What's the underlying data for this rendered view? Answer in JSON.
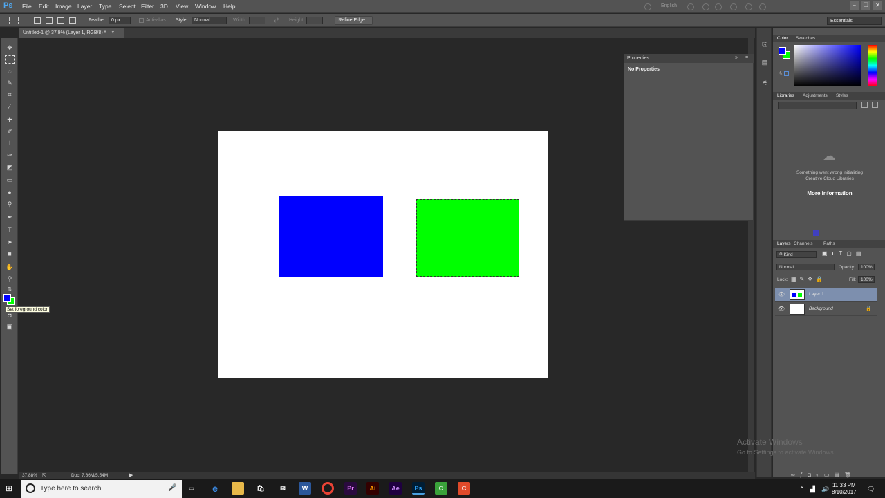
{
  "app": {
    "logo": "Ps"
  },
  "menu": [
    "File",
    "Edit",
    "Image",
    "Layer",
    "Type",
    "Select",
    "Filter",
    "3D",
    "View",
    "Window",
    "Help"
  ],
  "titlebar": {
    "language": "English",
    "minimize": "‒",
    "restore": "❐",
    "close": "✕"
  },
  "options": {
    "feather_label": "Feather:",
    "feather_value": "0 px",
    "antialias_label": "Anti-alias",
    "style_label": "Style:",
    "style_value": "Normal",
    "width_label": "Width:",
    "height_label": "Height:",
    "refine_edge": "Refine Edge...",
    "workspace": "Essentials"
  },
  "document": {
    "tab_title": "Untitled-1 @ 37.9% (Layer 1, RGB/8) *",
    "zoom": "37.88%",
    "doc_size": "Doc: 7.66M/5.54M",
    "colors": {
      "blue_rect": "#0000ff",
      "green_rect": "#00ff00"
    }
  },
  "toolbar": {
    "tooltip": "Set foreground color",
    "foreground": "#0000ff",
    "background": "#00ff00"
  },
  "properties": {
    "title": "Properties",
    "content": "No Properties"
  },
  "color_panel": {
    "tabs": [
      "Color",
      "Swatches"
    ]
  },
  "libraries_panel": {
    "tabs": [
      "Libraries",
      "Adjustments",
      "Styles"
    ],
    "error_line1": "Something went wrong initializing",
    "error_line2": "Creative Cloud Libraries",
    "more_info": "More information"
  },
  "layers_panel": {
    "tabs": [
      "Layers",
      "Channels",
      "Paths"
    ],
    "kind": "Kind",
    "blend_mode": "Normal",
    "opacity_label": "Opacity:",
    "opacity_value": "100%",
    "lock_label": "Lock:",
    "fill_label": "Fill:",
    "fill_value": "100%",
    "layers": [
      {
        "name": "Layer 1",
        "selected": true
      },
      {
        "name": "Background",
        "selected": false,
        "locked": true
      }
    ]
  },
  "watermark": {
    "line1": "Activate Windows",
    "line2": "Go to Settings to activate Windows."
  },
  "taskbar": {
    "search_placeholder": "Type here to search",
    "apps": [
      "task-view",
      "edge",
      "file-explorer",
      "store",
      "mail",
      "word",
      "chrome",
      "premiere",
      "illustrator",
      "after-effects",
      "photoshop",
      "camtasia",
      "camtasia-recorder"
    ],
    "time": "11:33 PM",
    "date": "8/10/2017"
  }
}
